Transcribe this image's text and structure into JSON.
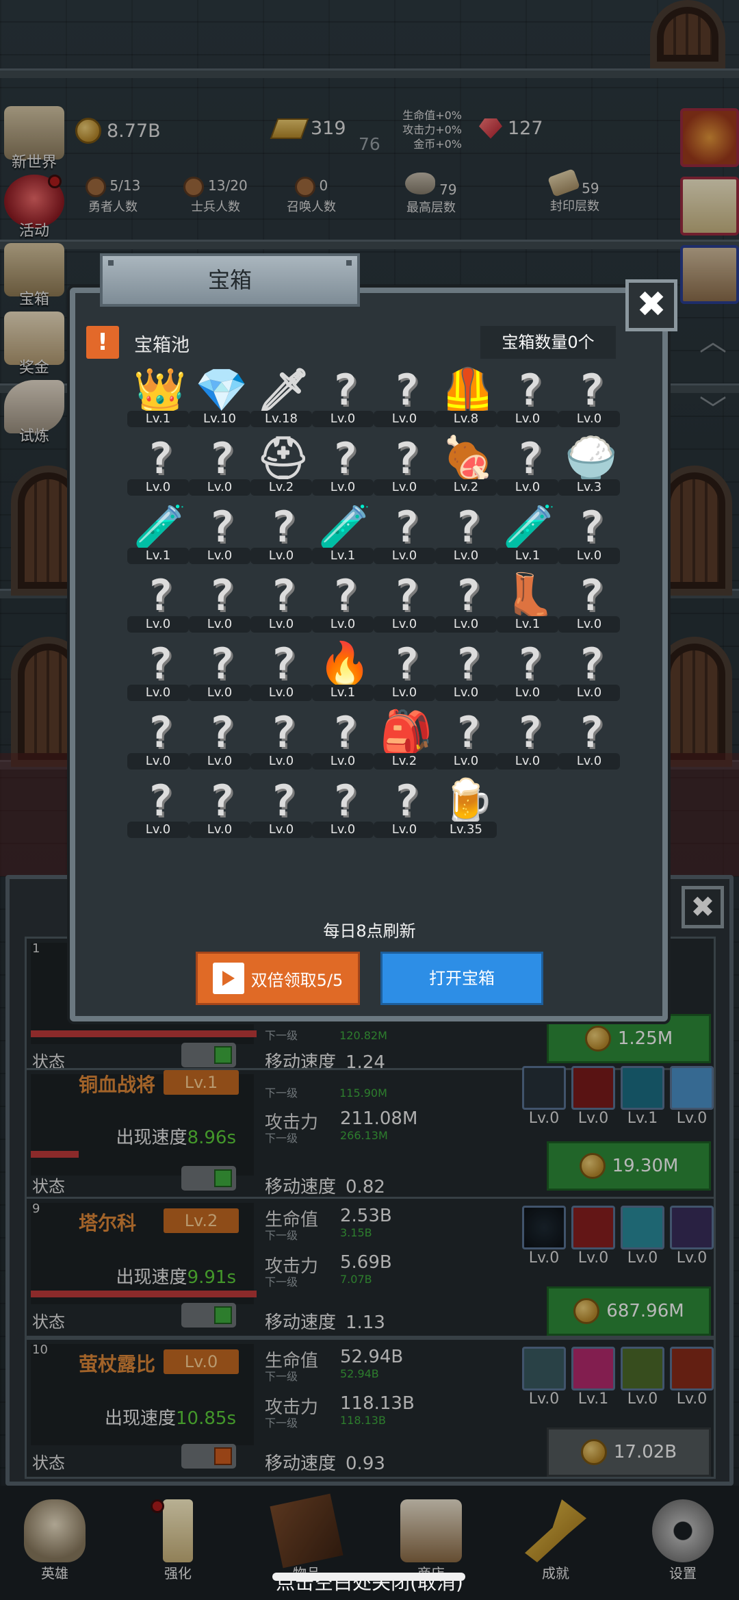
{
  "hud": {
    "gold": "8.77B",
    "bars": "319",
    "bars_sub": "76",
    "bonus_hp": "生命值+0%",
    "bonus_atk": "攻击力+0%",
    "bonus_gold": "金币+0%",
    "gems": "127",
    "heroes_val": "5/13",
    "heroes_lbl": "勇者人数",
    "soldiers_val": "13/20",
    "soldiers_lbl": "士兵人数",
    "summon_val": "0",
    "summon_lbl": "召唤人数",
    "floor_val": "79",
    "floor_lbl": "最高层数",
    "seal_val": "59",
    "seal_lbl": "封印层数"
  },
  "side_menu": [
    "新世界",
    "活动",
    "宝箱",
    "奖金",
    "试炼"
  ],
  "modal": {
    "title": "宝箱",
    "pool_title": "宝箱池",
    "count": "宝箱数量0个",
    "refresh_text": "每日8点刷新",
    "double_btn": "双倍领取5/5",
    "open_btn": "打开宝箱",
    "items": [
      {
        "icon": "crown-icon",
        "g": "👑",
        "lv": "Lv.1"
      },
      {
        "icon": "diamond-icon",
        "g": "💎",
        "lv": "Lv.10"
      },
      {
        "icon": "sword-icon",
        "g": "🗡",
        "lv": "Lv.18"
      },
      {
        "icon": "unknown-icon",
        "g": "?",
        "lv": "Lv.0"
      },
      {
        "icon": "unknown-icon",
        "g": "?",
        "lv": "Lv.0"
      },
      {
        "icon": "leather-armor-icon",
        "g": "🦺",
        "lv": "Lv.8"
      },
      {
        "icon": "unknown-icon",
        "g": "?",
        "lv": "Lv.0"
      },
      {
        "icon": "unknown-icon",
        "g": "?",
        "lv": "Lv.0"
      },
      {
        "icon": "unknown-icon",
        "g": "?",
        "lv": "Lv.0"
      },
      {
        "icon": "unknown-icon",
        "g": "?",
        "lv": "Lv.0"
      },
      {
        "icon": "knight-helmet-icon",
        "g": "⛑",
        "lv": "Lv.2"
      },
      {
        "icon": "unknown-icon",
        "g": "?",
        "lv": "Lv.0"
      },
      {
        "icon": "unknown-icon",
        "g": "?",
        "lv": "Lv.0"
      },
      {
        "icon": "meat-icon",
        "g": "🍖",
        "lv": "Lv.2"
      },
      {
        "icon": "unknown-icon",
        "g": "?",
        "lv": "Lv.0"
      },
      {
        "icon": "rice-bowl-icon",
        "g": "🍚",
        "lv": "Lv.3"
      },
      {
        "icon": "green-potion-icon",
        "g": "🧪",
        "lv": "Lv.1"
      },
      {
        "icon": "unknown-icon",
        "g": "?",
        "lv": "Lv.0"
      },
      {
        "icon": "unknown-icon",
        "g": "?",
        "lv": "Lv.0"
      },
      {
        "icon": "red-potion-icon",
        "g": "🧪",
        "lv": "Lv.1"
      },
      {
        "icon": "unknown-icon",
        "g": "?",
        "lv": "Lv.0"
      },
      {
        "icon": "unknown-icon",
        "g": "?",
        "lv": "Lv.0"
      },
      {
        "icon": "blue-potion-icon",
        "g": "🧪",
        "lv": "Lv.1"
      },
      {
        "icon": "unknown-icon",
        "g": "?",
        "lv": "Lv.0"
      },
      {
        "icon": "unknown-icon",
        "g": "?",
        "lv": "Lv.0"
      },
      {
        "icon": "unknown-icon",
        "g": "?",
        "lv": "Lv.0"
      },
      {
        "icon": "unknown-icon",
        "g": "?",
        "lv": "Lv.0"
      },
      {
        "icon": "unknown-icon",
        "g": "?",
        "lv": "Lv.0"
      },
      {
        "icon": "unknown-icon",
        "g": "?",
        "lv": "Lv.0"
      },
      {
        "icon": "unknown-icon",
        "g": "?",
        "lv": "Lv.0"
      },
      {
        "icon": "boots-icon",
        "g": "👢",
        "lv": "Lv.1"
      },
      {
        "icon": "unknown-icon",
        "g": "?",
        "lv": "Lv.0"
      },
      {
        "icon": "unknown-icon",
        "g": "?",
        "lv": "Lv.0"
      },
      {
        "icon": "unknown-icon",
        "g": "?",
        "lv": "Lv.0"
      },
      {
        "icon": "unknown-icon",
        "g": "?",
        "lv": "Lv.0"
      },
      {
        "icon": "torch-icon",
        "g": "🔥",
        "lv": "Lv.1"
      },
      {
        "icon": "unknown-icon",
        "g": "?",
        "lv": "Lv.0"
      },
      {
        "icon": "unknown-icon",
        "g": "?",
        "lv": "Lv.0"
      },
      {
        "icon": "unknown-icon",
        "g": "?",
        "lv": "Lv.0"
      },
      {
        "icon": "unknown-icon",
        "g": "?",
        "lv": "Lv.0"
      },
      {
        "icon": "unknown-icon",
        "g": "?",
        "lv": "Lv.0"
      },
      {
        "icon": "unknown-icon",
        "g": "?",
        "lv": "Lv.0"
      },
      {
        "icon": "unknown-icon",
        "g": "?",
        "lv": "Lv.0"
      },
      {
        "icon": "unknown-icon",
        "g": "?",
        "lv": "Lv.0"
      },
      {
        "icon": "backpack-icon",
        "g": "🎒",
        "lv": "Lv.2"
      },
      {
        "icon": "unknown-icon",
        "g": "?",
        "lv": "Lv.0"
      },
      {
        "icon": "unknown-icon",
        "g": "?",
        "lv": "Lv.0"
      },
      {
        "icon": "unknown-icon",
        "g": "?",
        "lv": "Lv.0"
      },
      {
        "icon": "unknown-icon",
        "g": "?",
        "lv": "Lv.0"
      },
      {
        "icon": "unknown-icon",
        "g": "?",
        "lv": "Lv.0"
      },
      {
        "icon": "unknown-icon",
        "g": "?",
        "lv": "Lv.0"
      },
      {
        "icon": "unknown-icon",
        "g": "?",
        "lv": "Lv.0"
      },
      {
        "icon": "unknown-icon",
        "g": "?",
        "lv": "Lv.0"
      },
      {
        "icon": "beer-mug-icon",
        "g": "🍺",
        "lv": "Lv.35"
      }
    ]
  },
  "cards": [
    {
      "num": "1",
      "state": "状态",
      "move_lbl": "移动速度",
      "move_val": "1.24",
      "next_lbl": "下一级",
      "next_val": "120.82M",
      "buy": "1.25M"
    },
    {
      "name": "铜血战将",
      "lv": "Lv.1",
      "speed_lbl": "出现速度",
      "speed_val": "8.96s",
      "state": "状态",
      "next_lbl1": "下一级",
      "next_val1": "115.90M",
      "atk_lbl": "攻击力",
      "atk_val": "211.08M",
      "next_lbl2": "下一级",
      "next_val2": "266.13M",
      "move_lbl": "移动速度",
      "move_val": "0.82",
      "skills": [
        "Lv.0",
        "Lv.0",
        "Lv.1",
        "Lv.0"
      ],
      "buy": "19.30M"
    },
    {
      "num": "9",
      "name": "塔尔科",
      "lv": "Lv.2",
      "speed_lbl": "出现速度",
      "speed_val": "9.91s",
      "state": "状态",
      "hp_lbl": "生命值",
      "hp_val": "2.53B",
      "next_lbl1": "下一级",
      "next_val1": "3.15B",
      "atk_lbl": "攻击力",
      "atk_val": "5.69B",
      "next_lbl2": "下一级",
      "next_val2": "7.07B",
      "move_lbl": "移动速度",
      "move_val": "1.13",
      "skills": [
        "Lv.0",
        "Lv.0",
        "Lv.0",
        "Lv.0"
      ],
      "buy": "687.96M"
    },
    {
      "num": "10",
      "name": "萤杖露比",
      "lv": "Lv.0",
      "speed_lbl": "出现速度",
      "speed_val": "10.85s",
      "state": "状态",
      "hp_lbl": "生命值",
      "hp_val": "52.94B",
      "next_lbl1": "下一级",
      "next_val1": "52.94B",
      "atk_lbl": "攻击力",
      "atk_val": "118.13B",
      "next_lbl2": "下一级",
      "next_val2": "118.13B",
      "move_lbl": "移动速度",
      "move_val": "0.93",
      "skills": [
        "Lv.0",
        "Lv.1",
        "Lv.0",
        "Lv.0"
      ],
      "buy": "17.02B"
    }
  ],
  "nav": [
    "英雄",
    "强化",
    "物品",
    "商店",
    "成就",
    "设置"
  ],
  "hint": "点击空白处关闭(取消)",
  "colors": {
    "accent_orange": "#e06a26",
    "accent_blue": "#2d8ee6",
    "buy_green": "#2f8c3a"
  }
}
